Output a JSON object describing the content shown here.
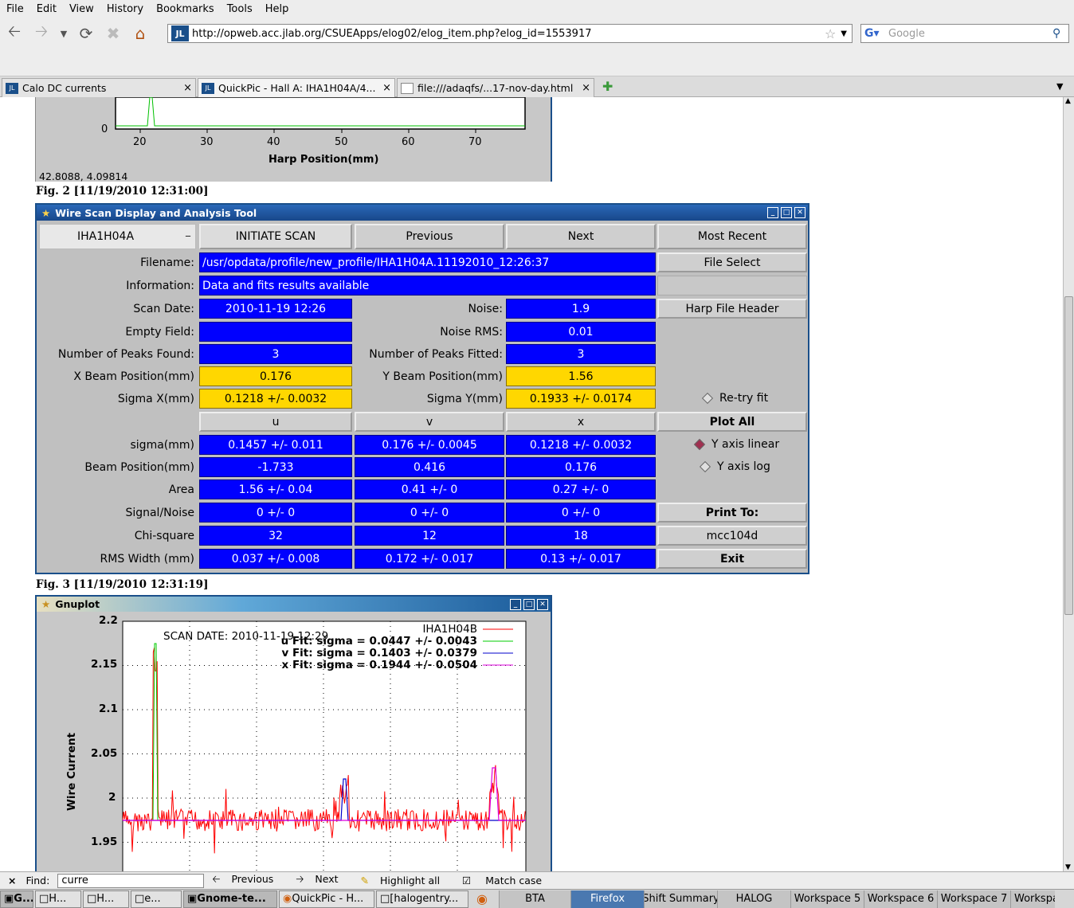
{
  "menu": [
    "File",
    "Edit",
    "View",
    "History",
    "Bookmarks",
    "Tools",
    "Help"
  ],
  "url": "http://opweb.acc.jlab.org/CSUEApps/elog02/elog_item.php?elog_id=1553917",
  "search_placeholder": "Google",
  "tabs": [
    {
      "label": "Calo DC currents"
    },
    {
      "label": "QuickPic - Hall A: IHA1H04A/4..."
    },
    {
      "label": "file:///adaqfs/...17-nov-day.html"
    }
  ],
  "fig1": {
    "xlabel": "Harp Position(mm)",
    "xticks": [
      "20",
      "30",
      "40",
      "50",
      "60",
      "70"
    ],
    "yzero": "0",
    "coords": "42.8088,  4.09814"
  },
  "captions": {
    "fig2": "Fig. 2 [11/19/2010 12:31:00]",
    "fig3": "Fig. 3 [11/19/2010 12:31:19]"
  },
  "wsd": {
    "title": "Wire Scan Display and Analysis Tool",
    "harp": "IHA1H04A",
    "initiate": "INITIATE SCAN",
    "previous": "Previous",
    "next": "Next",
    "most_recent": "Most Recent",
    "filename_label": "Filename:",
    "filename": "/usr/opdata/profile/new_profile/IHA1H04A.11192010_12:26:37",
    "file_select": "File Select",
    "info_label": "Information:",
    "info": "Data and fits results available",
    "scan_date_label": "Scan Date:",
    "scan_date": "2010-11-19   12:26",
    "noise_label": "Noise:",
    "noise": "1.9",
    "harp_header": "Harp File Header",
    "empty_field_label": "Empty Field:",
    "noise_rms_label": "Noise RMS:",
    "noise_rms": "0.01",
    "peaks_found_label": "Number of Peaks Found:",
    "peaks_found": "3",
    "peaks_fitted_label": "Number of Peaks Fitted:",
    "peaks_fitted": "3",
    "xbeam_label": "X Beam Position(mm)",
    "xbeam": "0.176",
    "ybeam_label": "Y Beam Position(mm)",
    "ybeam": "1.56",
    "sigx_label": "Sigma X(mm)",
    "sigx": "0.1218 +/- 0.0032",
    "sigy_label": "Sigma Y(mm)",
    "sigy": "0.1933 +/- 0.0174",
    "retry": "Re-try fit",
    "col_u": "u",
    "col_v": "v",
    "col_x": "x",
    "plot_all": "Plot All",
    "ylinear": "Y axis linear",
    "ylog": "Y axis log",
    "print_to": "Print To:",
    "printer": "mcc104d",
    "exit": "Exit",
    "rows": [
      {
        "label": "sigma(mm)",
        "u": "0.1457 +/- 0.011",
        "v": "0.176 +/- 0.0045",
        "x": "0.1218 +/- 0.0032"
      },
      {
        "label": "Beam Position(mm)",
        "u": "-1.733",
        "v": "0.416",
        "x": "0.176"
      },
      {
        "label": "Area",
        "u": "1.56 +/- 0.04",
        "v": "0.41 +/- 0",
        "x": "0.27 +/- 0"
      },
      {
        "label": "Signal/Noise",
        "u": "0 +/- 0",
        "v": "0 +/- 0",
        "x": "0 +/- 0"
      },
      {
        "label": "Chi-square",
        "u": "32",
        "v": "12",
        "x": "18"
      },
      {
        "label": "RMS Width (mm)",
        "u": "0.037 +/- 0.008",
        "v": "0.172 +/- 0.017",
        "x": "0.13 +/- 0.017"
      }
    ]
  },
  "gnuplot": {
    "title": "Gnuplot",
    "ylabel": "Wire Current",
    "yticks": [
      "2.2",
      "2.15",
      "2.1",
      "2.05",
      "2",
      "1.95"
    ],
    "scan_date": "SCAN DATE: 2010-11-19   12:29",
    "legend": [
      {
        "text": "IHA1H04B",
        "color": "#ff0000"
      },
      {
        "text": "u  Fit: sigma = 0.0447 +/- 0.0043",
        "color": "#00cc00"
      },
      {
        "text": "v  Fit: sigma = 0.1403 +/- 0.0379",
        "color": "#0000cc"
      },
      {
        "text": "x  Fit: sigma = 0.1944 +/- 0.0504",
        "color": "#dd00dd"
      }
    ]
  },
  "find": {
    "label": "Find:",
    "value": "curre",
    "previous": "Previous",
    "next": "Next",
    "highlight": "Highlight all",
    "match": "Match case"
  },
  "taskbar": {
    "items": [
      "G...",
      "H...",
      "H...",
      "e...",
      "Gnome-te...",
      "QuickPic - H...",
      "[halogentry..."
    ],
    "workspaces": [
      "BTA",
      "Firefox",
      "Shift Summary",
      "HALOG",
      "Workspace 5",
      "Workspace 6",
      "Workspace 7",
      "Workspa"
    ]
  }
}
